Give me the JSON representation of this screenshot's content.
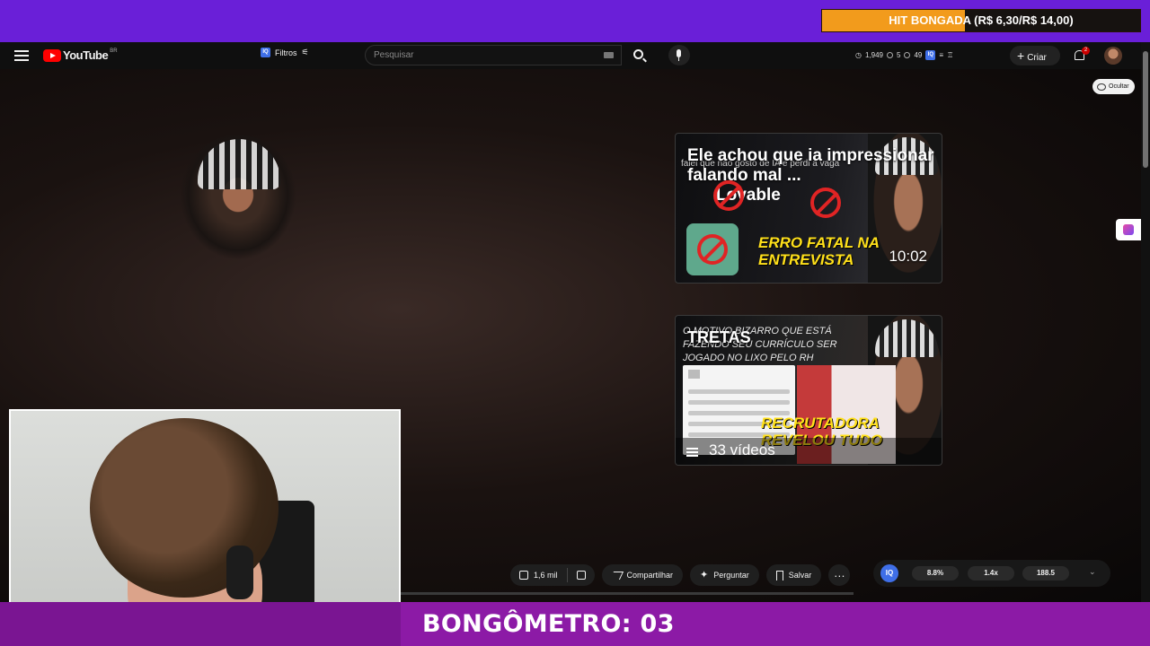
{
  "overlay": {
    "hit_banner": "HIT BONGADA (R$ 6,30/R$ 14,00)",
    "hit_progress": 0.45,
    "counter": "BONGÔMETRO: 03"
  },
  "header": {
    "logo": "YouTube",
    "country": "BR",
    "filters_label": "Filtros",
    "search_placeholder": "Pesquisar",
    "stats": [
      "1,949",
      "5",
      "49"
    ],
    "create_label": "Criar",
    "notification_count": "2"
  },
  "player": {
    "hide_label": "Ocultar",
    "progress": 1.0
  },
  "end_screen": {
    "card1": {
      "title": "Ele achou que ia impressionar falando mal ...",
      "overlay_caption": "falei que não gosto de IA e perdi a vaga",
      "brand": "Lovable",
      "yellow_text": "ERRO FATAL NA ENTREVISTA",
      "duration": "10:02"
    },
    "card2": {
      "title": "TRETAS",
      "overlay_caption": "O MOTIVO BIZARRO QUE ESTÁ FAZENDO SEU CURRÍCULO SER JOGADO NO LIXO PELO RH",
      "yellow_text": "RECRUTADORA REVELOU TUDO",
      "video_count": "33 vídeos"
    }
  },
  "actions": {
    "likes": "1,6 mil",
    "share": "Compartilhar",
    "ask": "Perguntar",
    "save": "Salvar"
  },
  "iq_stats": {
    "badge": "IQ",
    "values": [
      "8.8%",
      "1.4x",
      "188.5"
    ]
  },
  "colors": {
    "overlay_purple": "#6a1fd8",
    "bottom_magenta": "#8c1aa6",
    "banner_orange": "#f29b1c",
    "yt_red": "#ff0000",
    "yellow": "#ffe01a"
  }
}
